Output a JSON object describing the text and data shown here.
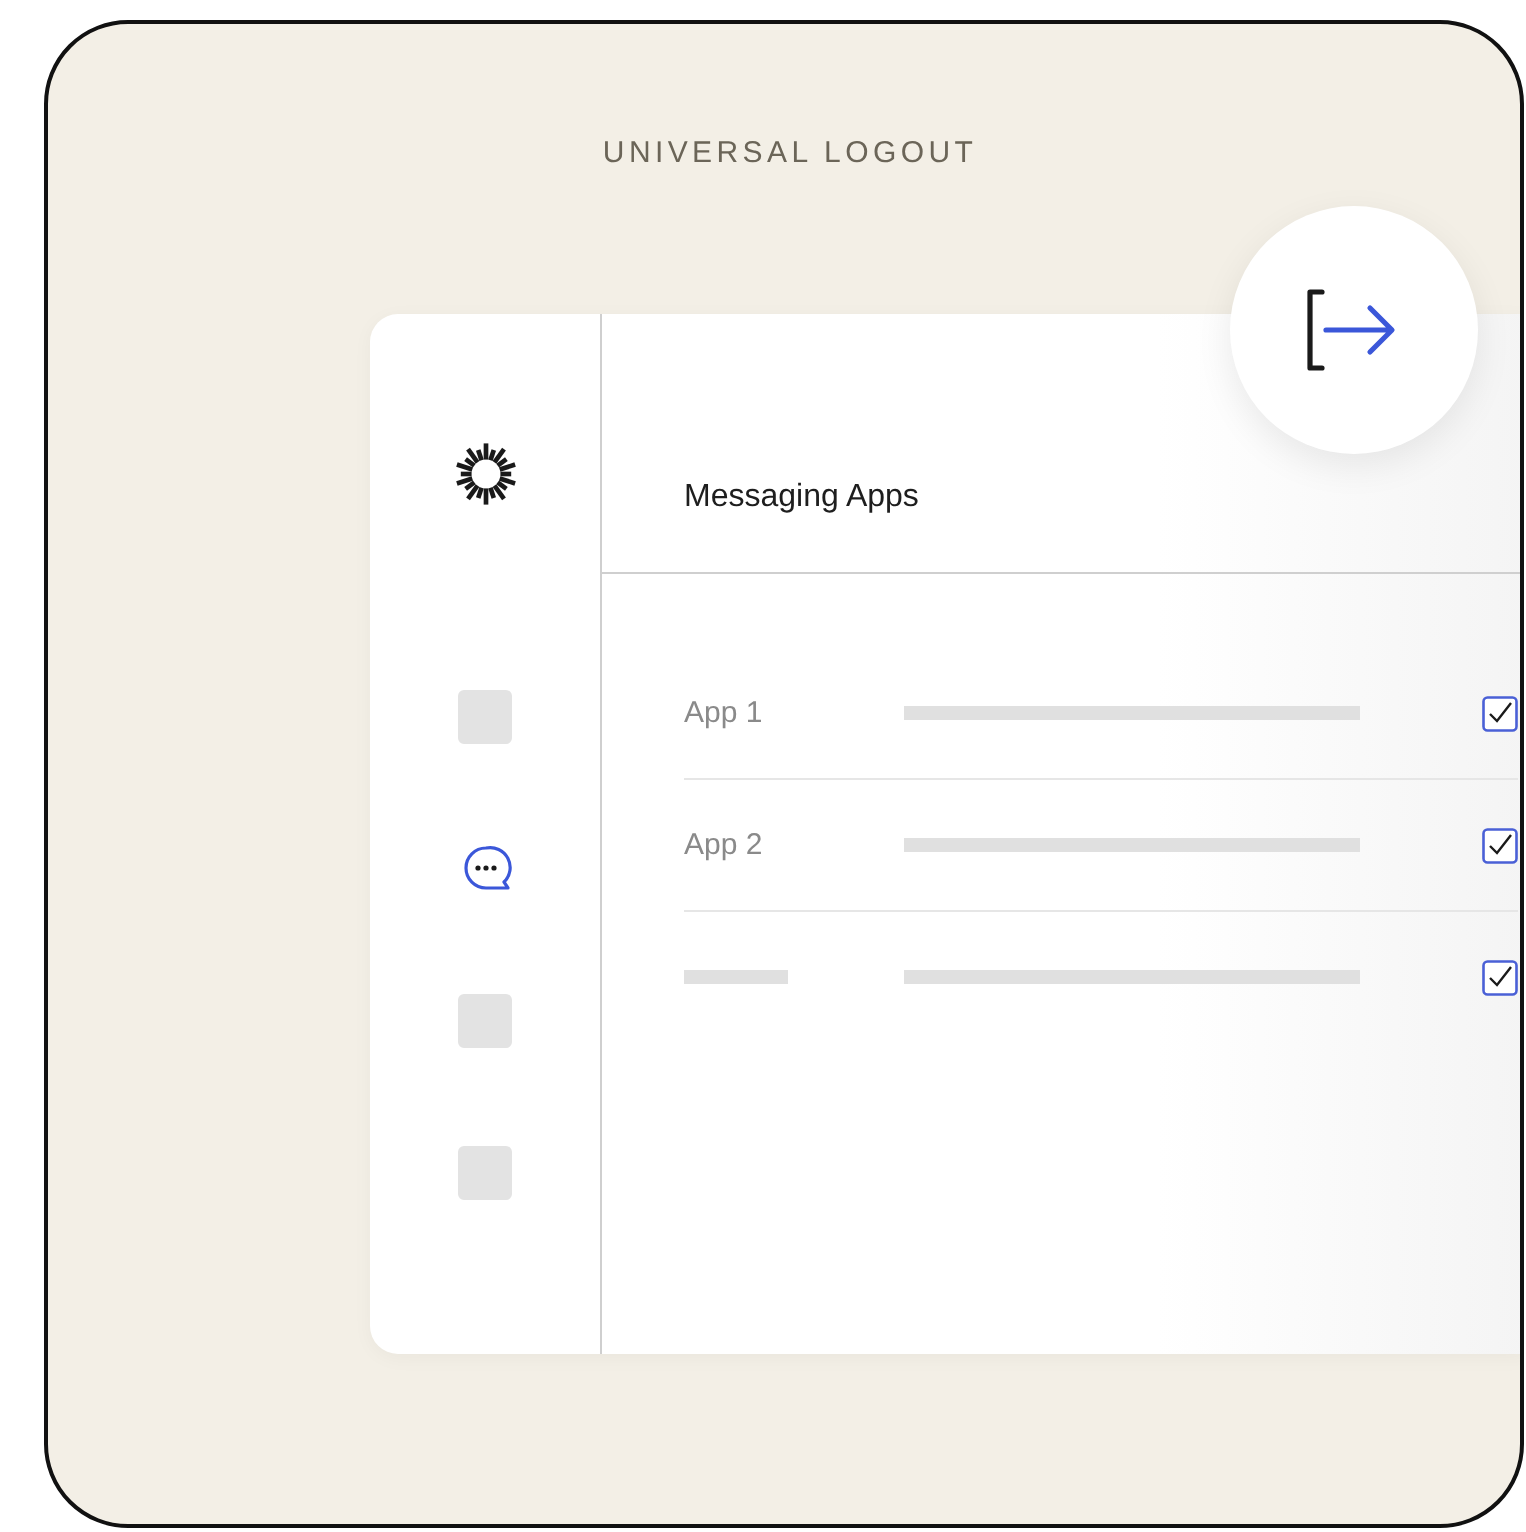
{
  "title": "UNIVERSAL LOGOUT",
  "sidebar": {
    "items": [
      {
        "kind": "placeholder",
        "selected": false
      },
      {
        "kind": "chat",
        "selected": true
      },
      {
        "kind": "placeholder",
        "selected": false
      },
      {
        "kind": "placeholder",
        "selected": false
      }
    ]
  },
  "panel": {
    "heading": "Messaging Apps",
    "rows": [
      {
        "label": "App 1",
        "checked": true
      },
      {
        "label": "App 2",
        "checked": true
      },
      {
        "checked": true
      }
    ]
  }
}
